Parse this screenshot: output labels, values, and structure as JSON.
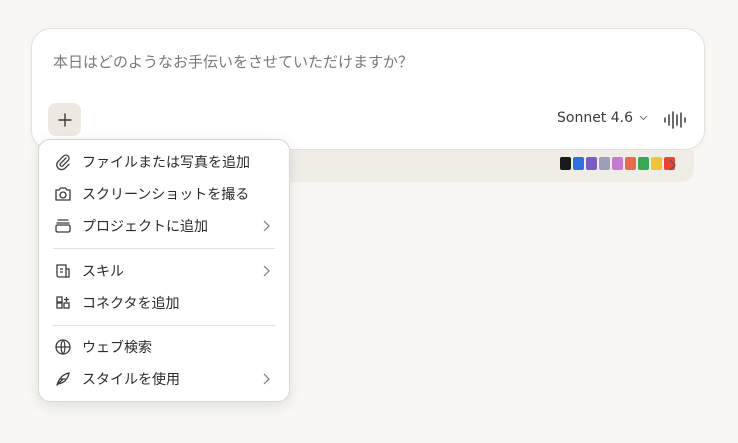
{
  "composer": {
    "placeholder": "本日はどのようなお手伝いをさせていただけますか？",
    "model_label": "Sonnet 4.6"
  },
  "tray": {
    "connector_colors": [
      "#1a1a1a",
      "#2f6fdf",
      "#7a5cc2",
      "#9aa0b8",
      "#c47bd1",
      "#e86a4a",
      "#3aa757",
      "#f1c232",
      "#ea4335"
    ]
  },
  "menu": {
    "groups": [
      [
        {
          "label": "ファイルまたは写真を追加",
          "icon": "paperclip-icon",
          "submenu": false
        },
        {
          "label": "スクリーンショットを撮る",
          "icon": "camera-icon",
          "submenu": false
        },
        {
          "label": "プロジェクトに追加",
          "icon": "project-icon",
          "submenu": true
        }
      ],
      [
        {
          "label": "スキル",
          "icon": "skill-icon",
          "submenu": true
        },
        {
          "label": "コネクタを追加",
          "icon": "connector-icon",
          "submenu": false
        }
      ],
      [
        {
          "label": "ウェブ検索",
          "icon": "globe-icon",
          "submenu": false
        },
        {
          "label": "スタイルを使用",
          "icon": "feather-icon",
          "submenu": true
        }
      ]
    ]
  }
}
